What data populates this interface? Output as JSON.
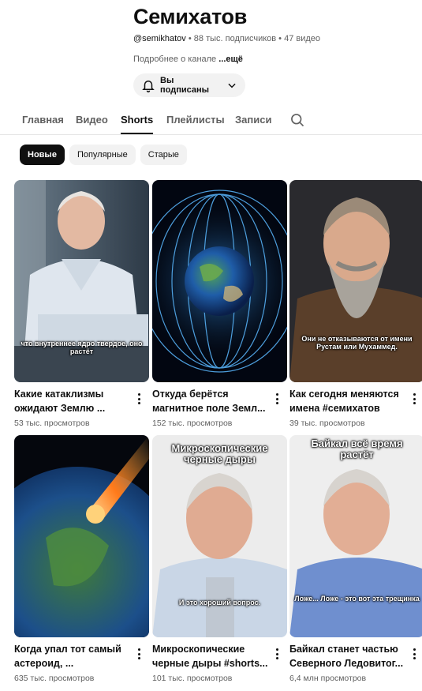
{
  "channel": {
    "name": "Семихатов",
    "handle": "@semikhatov",
    "subscribers": " • 88 тыс. подписчиков • 47 видео",
    "about_prefix": "Подробнее о канале ",
    "about_more": "...ещё",
    "subscribed_label": "Вы подписаны"
  },
  "tabs": [
    "Главная",
    "Видео",
    "Shorts",
    "Плейлисты",
    "Записи"
  ],
  "active_tab": "Shorts",
  "chips": [
    "Новые",
    "Популярные",
    "Старые"
  ],
  "active_chip": "Новые",
  "videos": [
    {
      "title": "Какие катаклизмы ожидают Землю ...",
      "views": "53 тыс. просмотров",
      "caption": "что внутреннее ядро твердое, оно растёт",
      "thumb": "man-studio"
    },
    {
      "title": "Откуда берётся магнитное поле Земл...",
      "views": "152 тыс. просмотров",
      "caption": "",
      "thumb": "earth-field"
    },
    {
      "title": "Как сегодня меняются имена #семихатов",
      "views": "39 тыс. просмотров",
      "caption": "Они не отказываются от имени Рустам или Мухаммед.",
      "thumb": "bearded-man"
    },
    {
      "title": "Когда упал тот самый астероид, ...",
      "views": "635 тыс. просмотров",
      "caption": "",
      "thumb": "asteroid"
    },
    {
      "title": "Микроскопические черные дыры #shorts...",
      "views": "101 тыс. просмотров",
      "caption_top": "Микроскопические черные дыры",
      "caption": "И это хороший вопрос.",
      "thumb": "man-light"
    },
    {
      "title": "Байкал станет частью Северного Ледовитог...",
      "views": "6,4 млн просмотров",
      "caption_top": "Байкал всё время растёт",
      "caption": "Ложе... Ложе - это вот эта трещинка",
      "thumb": "man-light-2"
    }
  ],
  "colors": {
    "text": "#0f0f0f",
    "secondary": "#606060",
    "chip_bg": "#f2f2f2"
  }
}
